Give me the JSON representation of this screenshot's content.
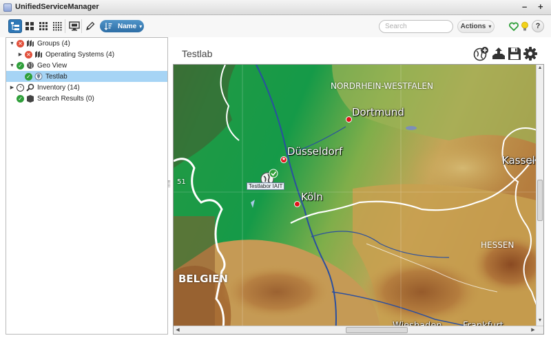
{
  "window": {
    "title": "UnifiedServiceManager",
    "minimize_glyph": "–",
    "close_glyph": "+"
  },
  "toolbar": {
    "sort_label": "Name",
    "search_placeholder": "Search",
    "actions_label": "Actions",
    "help_label": "?",
    "caret": "▾",
    "icons": [
      "tree-view-icon",
      "large-grid-icon",
      "medium-grid-icon",
      "small-grid-icon",
      "monitor-icon",
      "pencil-icon",
      "sort-icon",
      "heart-icon",
      "lightbulb-icon"
    ],
    "colors": {
      "active_blue": "#2f78b7",
      "heart_green": "#2f9f3a",
      "bulb_yellow": "#f2d21b"
    }
  },
  "tree": {
    "items": [
      {
        "label": "Groups (4)",
        "arrow": "▼",
        "status": "error",
        "status_glyph": "✕",
        "icon": "groups-icon"
      },
      {
        "label": "Operating Systems (4)",
        "arrow": "▶",
        "status": "error",
        "status_glyph": "✕",
        "icon": "operating-systems-icon"
      },
      {
        "label": "Geo View",
        "arrow": "▼",
        "status": "ok",
        "status_glyph": "✓",
        "icon": "globe-icon"
      },
      {
        "label": "Testlab",
        "arrow": "",
        "status": "ok",
        "status_glyph": "✓",
        "icon": "location-icon",
        "selected": true
      },
      {
        "label": "Inventory (14)",
        "arrow": "▶",
        "status": "clock",
        "status_glyph": "◔",
        "icon": "search-icon"
      },
      {
        "label": "Search Results (0)",
        "arrow": "",
        "status": "ok",
        "status_glyph": "✓",
        "icon": "results-icon"
      }
    ]
  },
  "content": {
    "title": "Testlab",
    "tools": [
      "add-location-icon",
      "upload-icon",
      "save-icon",
      "settings-icon"
    ]
  },
  "map": {
    "regions": [
      "NORDRHEIN-WESTFALEN",
      "HESSEN",
      "BELGIEN"
    ],
    "cities": [
      "Dortmund",
      "Düsseldorf",
      "Köln",
      "Kassel",
      "Wiesbaden",
      "Frankfurt"
    ],
    "grid_label": "51",
    "marker_label": "Testlabor IAIT",
    "scroll_up": "▲",
    "scroll_down": "▼",
    "scroll_left": "◀",
    "scroll_right": "▶",
    "colors": {
      "lowland": "#1e8f3c",
      "upland": "#c8a050",
      "mountain": "#9b5a2a",
      "river": "#2a4fa0",
      "border": "#ffffff"
    }
  }
}
